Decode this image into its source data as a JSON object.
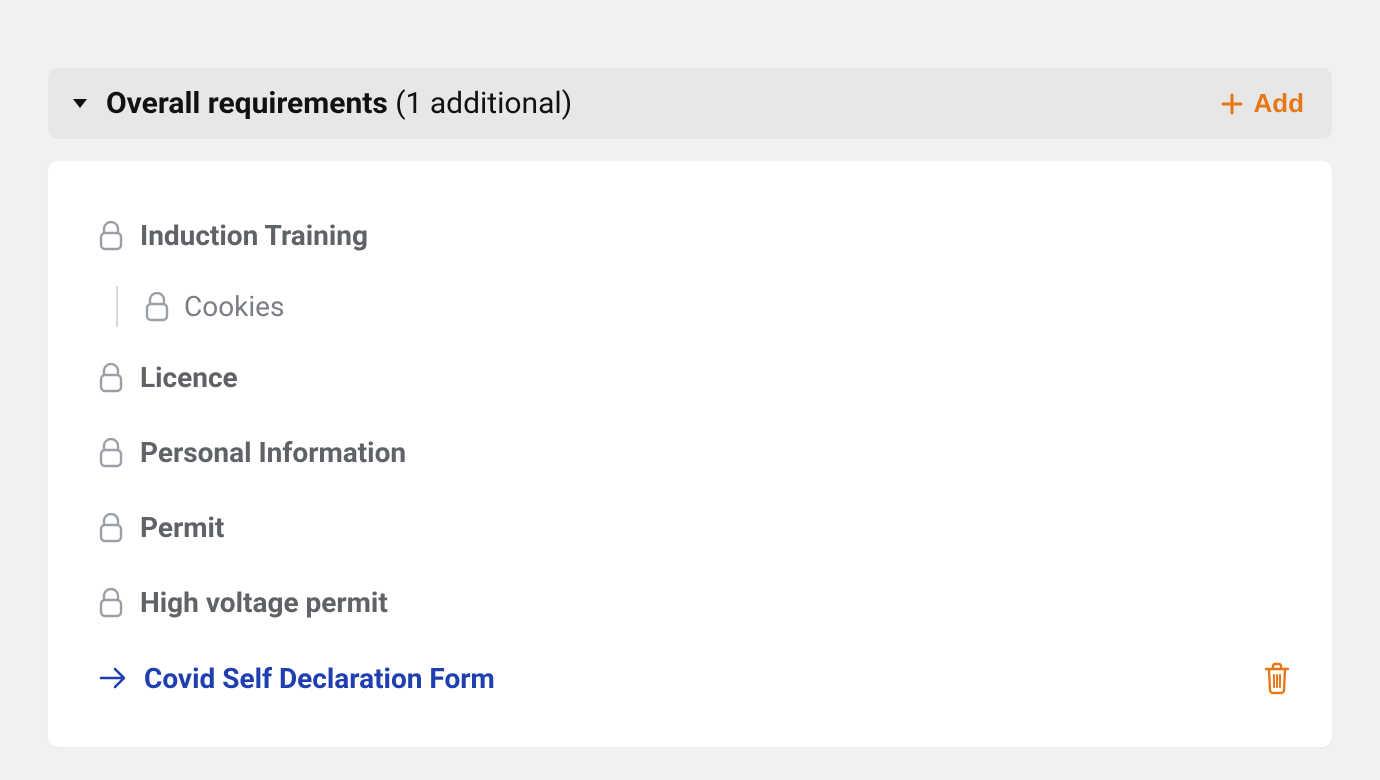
{
  "header": {
    "title_bold": "Overall requirements",
    "title_muted": "(1 additional)",
    "add_label": "Add"
  },
  "requirements": {
    "items": [
      {
        "label": "Induction Training"
      },
      {
        "label": "Licence"
      },
      {
        "label": "Personal Information"
      },
      {
        "label": "Permit"
      },
      {
        "label": "High voltage permit"
      }
    ],
    "sub_item": {
      "label": "Cookies"
    },
    "additional": {
      "label": "Covid Self Declaration Form"
    }
  },
  "colors": {
    "accent": "#e67817",
    "link": "#1f3fb0",
    "text_muted": "#5f6368"
  }
}
